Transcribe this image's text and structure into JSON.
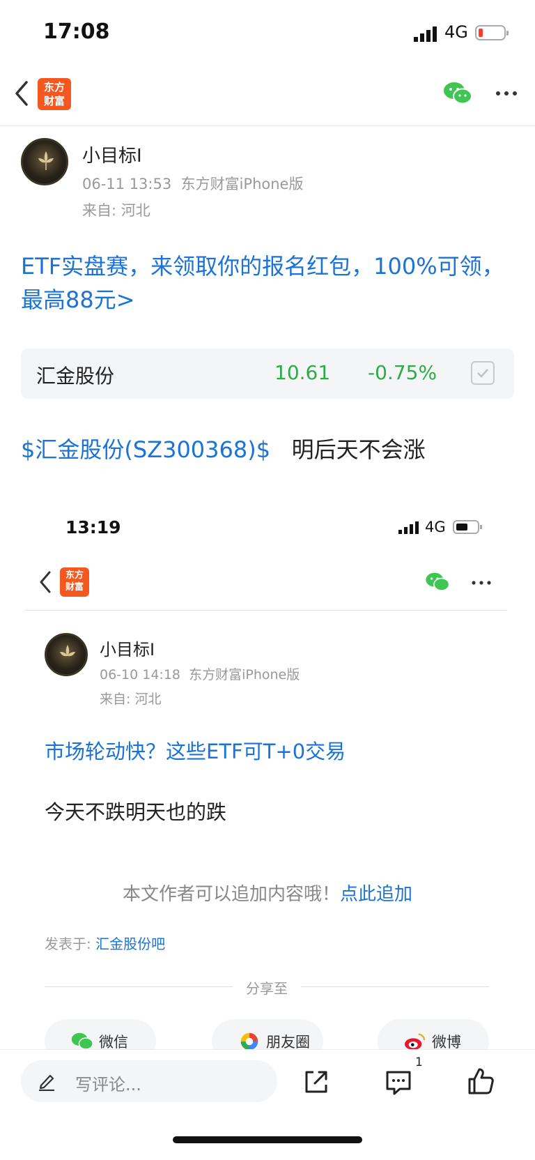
{
  "status_bar": {
    "time": "17:08",
    "network": "4G"
  },
  "nav": {
    "logo_line1": "东方",
    "logo_line2": "财富"
  },
  "post": {
    "author": "小目标I",
    "meta_time": "06-11 13:53",
    "meta_device": "东方财富iPhone版",
    "meta_from": "来自: 河北",
    "promo_link": "ETF实盘赛，来领取你的报名红包，100%可领，最高88元>",
    "stock": {
      "name": "汇金股份",
      "price": "10.61",
      "change": "-0.75%"
    },
    "body_tag": "$汇金股份(SZ300368)$",
    "body_text": "明后天不会涨"
  },
  "embedded": {
    "time": "13:19",
    "network": "4G",
    "logo_line1": "东方",
    "logo_line2": "财富",
    "author": "小目标I",
    "meta_time": "06-10 14:18",
    "meta_device": "东方财富iPhone版",
    "meta_from": "来自: 河北",
    "promo_link": "市场轮动快？这些ETF可T+0交易",
    "body_text": "今天不跌明天也的跌"
  },
  "append": {
    "text": "本文作者可以追加内容哦！",
    "link": "点此追加"
  },
  "posted_in": {
    "label": "发表于:",
    "forum": "汇金股份吧"
  },
  "share": {
    "label": "分享至",
    "items": [
      {
        "label": "微信",
        "icon": "wechat-icon"
      },
      {
        "label": "朋友圈",
        "icon": "moments-icon"
      },
      {
        "label": "微博",
        "icon": "weibo-icon"
      }
    ]
  },
  "bottom_bar": {
    "comment_placeholder": "写评论...",
    "comment_count": "1"
  },
  "colors": {
    "link": "#1a73d6",
    "down": "#2eab48",
    "brand": "#f4581f"
  }
}
